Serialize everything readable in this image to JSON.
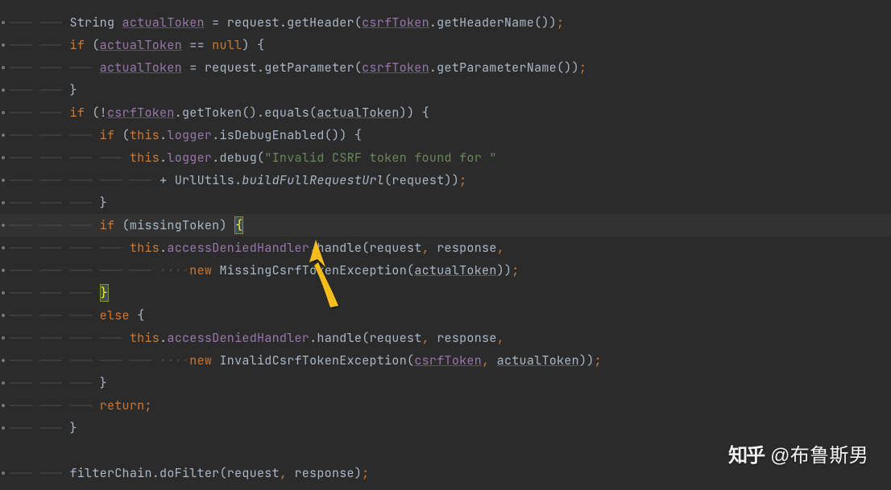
{
  "ws_arrow": "———",
  "ws_dots": "····",
  "lines": [
    {
      "indent_tabs": 2,
      "indent_spaces": 0,
      "highlight": false,
      "dot": true,
      "tokens": [
        {
          "t": "String ",
          "c": "ident"
        },
        {
          "t": "actualToken",
          "c": "field"
        },
        {
          "t": " = request.getHeader(",
          "c": "ident"
        },
        {
          "t": "csrfToken",
          "c": "field"
        },
        {
          "t": ".getHeaderName())",
          "c": "ident"
        },
        {
          "t": ";",
          "c": "punct"
        }
      ]
    },
    {
      "indent_tabs": 2,
      "indent_spaces": 0,
      "highlight": false,
      "dot": true,
      "tokens": [
        {
          "t": "if",
          "c": "kw"
        },
        {
          "t": " (",
          "c": "ident"
        },
        {
          "t": "actualToken",
          "c": "field"
        },
        {
          "t": " == ",
          "c": "ident"
        },
        {
          "t": "null",
          "c": "kw"
        },
        {
          "t": ") {",
          "c": "ident"
        }
      ]
    },
    {
      "indent_tabs": 3,
      "indent_spaces": 0,
      "highlight": false,
      "dot": true,
      "tokens": [
        {
          "t": "actualToken",
          "c": "field"
        },
        {
          "t": " = request.getParameter(",
          "c": "ident"
        },
        {
          "t": "csrfToken",
          "c": "field"
        },
        {
          "t": ".getParameterName())",
          "c": "ident"
        },
        {
          "t": ";",
          "c": "punct"
        }
      ]
    },
    {
      "indent_tabs": 2,
      "indent_spaces": 0,
      "highlight": false,
      "dot": true,
      "tokens": [
        {
          "t": "}",
          "c": "ident"
        }
      ]
    },
    {
      "indent_tabs": 2,
      "indent_spaces": 0,
      "highlight": false,
      "dot": true,
      "tokens": [
        {
          "t": "if",
          "c": "kw"
        },
        {
          "t": " (!",
          "c": "ident"
        },
        {
          "t": "csrfToken",
          "c": "field"
        },
        {
          "t": ".getToken().equals(",
          "c": "ident"
        },
        {
          "t": "actualToken",
          "c": "und"
        },
        {
          "t": ")) {",
          "c": "ident"
        }
      ]
    },
    {
      "indent_tabs": 3,
      "indent_spaces": 0,
      "highlight": false,
      "dot": true,
      "tokens": [
        {
          "t": "if",
          "c": "kw"
        },
        {
          "t": " (",
          "c": "ident"
        },
        {
          "t": "this",
          "c": "kw"
        },
        {
          "t": ".",
          "c": "ident"
        },
        {
          "t": "logger",
          "c": "field-nou"
        },
        {
          "t": ".isDebugEnabled()) {",
          "c": "ident"
        }
      ]
    },
    {
      "indent_tabs": 4,
      "indent_spaces": 0,
      "highlight": false,
      "dot": true,
      "tokens": [
        {
          "t": "this",
          "c": "kw"
        },
        {
          "t": ".",
          "c": "ident"
        },
        {
          "t": "logger",
          "c": "field-nou"
        },
        {
          "t": ".debug(",
          "c": "ident"
        },
        {
          "t": "\"Invalid CSRF token found for \"",
          "c": "str"
        }
      ]
    },
    {
      "indent_tabs": 5,
      "indent_spaces": 0,
      "highlight": false,
      "dot": true,
      "tokens": [
        {
          "t": "+ UrlUtils.",
          "c": "ident"
        },
        {
          "t": "buildFullRequestUrl",
          "c": "static"
        },
        {
          "t": "(request))",
          "c": "ident"
        },
        {
          "t": ";",
          "c": "punct"
        }
      ]
    },
    {
      "indent_tabs": 3,
      "indent_spaces": 0,
      "highlight": false,
      "dot": true,
      "tokens": [
        {
          "t": "}",
          "c": "ident"
        }
      ]
    },
    {
      "indent_tabs": 3,
      "indent_spaces": 0,
      "highlight": true,
      "dot": true,
      "tokens": [
        {
          "t": "if",
          "c": "kw"
        },
        {
          "t": " (missingToken) ",
          "c": "ident"
        },
        {
          "t": "{",
          "c": "bracket-match"
        }
      ]
    },
    {
      "indent_tabs": 4,
      "indent_spaces": 0,
      "highlight": false,
      "dot": true,
      "tokens": [
        {
          "t": "this",
          "c": "kw"
        },
        {
          "t": ".",
          "c": "ident"
        },
        {
          "t": "accessDeniedHandler",
          "c": "field-nou"
        },
        {
          "t": ".handle(request",
          "c": "ident"
        },
        {
          "t": ",",
          "c": "punct"
        },
        {
          "t": " response",
          "c": "ident"
        },
        {
          "t": ",",
          "c": "punct"
        }
      ]
    },
    {
      "indent_tabs": 5,
      "indent_spaces": 1,
      "highlight": false,
      "dot": true,
      "tokens": [
        {
          "t": "new",
          "c": "kw"
        },
        {
          "t": " MissingCsrfTokenException(",
          "c": "ident"
        },
        {
          "t": "actualToken",
          "c": "und"
        },
        {
          "t": "))",
          "c": "ident"
        },
        {
          "t": ";",
          "c": "punct"
        }
      ]
    },
    {
      "indent_tabs": 3,
      "indent_spaces": 0,
      "highlight": false,
      "dot": true,
      "tokens": [
        {
          "t": "}",
          "c": "bracket-match"
        }
      ]
    },
    {
      "indent_tabs": 3,
      "indent_spaces": 0,
      "highlight": false,
      "dot": true,
      "tokens": [
        {
          "t": "else",
          "c": "kw"
        },
        {
          "t": " {",
          "c": "ident"
        }
      ]
    },
    {
      "indent_tabs": 4,
      "indent_spaces": 0,
      "highlight": false,
      "dot": true,
      "tokens": [
        {
          "t": "this",
          "c": "kw"
        },
        {
          "t": ".",
          "c": "ident"
        },
        {
          "t": "accessDeniedHandler",
          "c": "field-nou"
        },
        {
          "t": ".handle(request",
          "c": "ident"
        },
        {
          "t": ",",
          "c": "punct"
        },
        {
          "t": " response",
          "c": "ident"
        },
        {
          "t": ",",
          "c": "punct"
        }
      ]
    },
    {
      "indent_tabs": 5,
      "indent_spaces": 1,
      "highlight": false,
      "dot": true,
      "tokens": [
        {
          "t": "new",
          "c": "kw"
        },
        {
          "t": " InvalidCsrfTokenException(",
          "c": "ident"
        },
        {
          "t": "csrfToken",
          "c": "field"
        },
        {
          "t": ",",
          "c": "punct"
        },
        {
          "t": " ",
          "c": "ident"
        },
        {
          "t": "actualToken",
          "c": "und"
        },
        {
          "t": "))",
          "c": "ident"
        },
        {
          "t": ";",
          "c": "punct"
        }
      ]
    },
    {
      "indent_tabs": 3,
      "indent_spaces": 0,
      "highlight": false,
      "dot": true,
      "tokens": [
        {
          "t": "}",
          "c": "ident"
        }
      ]
    },
    {
      "indent_tabs": 3,
      "indent_spaces": 0,
      "highlight": false,
      "dot": true,
      "tokens": [
        {
          "t": "return;",
          "c": "kw"
        }
      ]
    },
    {
      "indent_tabs": 2,
      "indent_spaces": 0,
      "highlight": false,
      "dot": true,
      "tokens": [
        {
          "t": "}",
          "c": "ident"
        }
      ]
    },
    {
      "indent_tabs": 0,
      "indent_spaces": 0,
      "highlight": false,
      "dot": false,
      "tokens": []
    },
    {
      "indent_tabs": 2,
      "indent_spaces": 0,
      "highlight": false,
      "dot": true,
      "tokens": [
        {
          "t": "filterChain.doFilter(request",
          "c": "ident"
        },
        {
          "t": ",",
          "c": "punct"
        },
        {
          "t": " response)",
          "c": "ident"
        },
        {
          "t": ";",
          "c": "punct"
        }
      ]
    }
  ],
  "watermark": {
    "brand": "知乎",
    "handle": "@布鲁斯男"
  }
}
